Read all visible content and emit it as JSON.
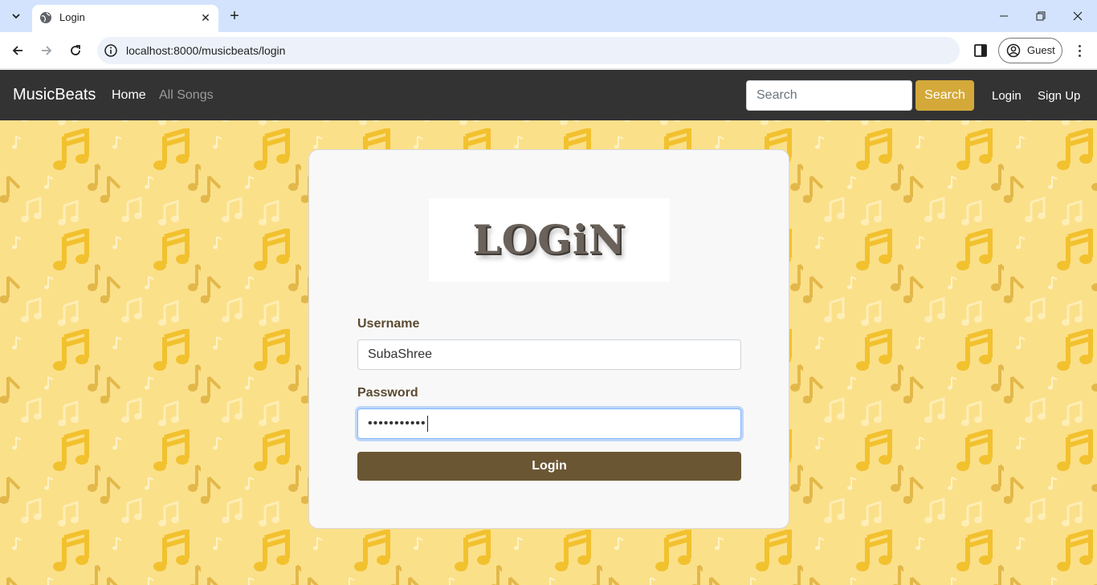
{
  "browser": {
    "tab_title": "Login",
    "url": "localhost:8000/musicbeats/login",
    "profile_label": "Guest"
  },
  "navbar": {
    "brand": "MusicBeats",
    "home": "Home",
    "all_songs": "All Songs",
    "search_placeholder": "Search",
    "search_button": "Search",
    "login": "Login",
    "signup": "Sign Up"
  },
  "login_form": {
    "logo_text": "LOGiN",
    "username_label": "Username",
    "username_value": "SubaShree",
    "password_label": "Password",
    "password_masked": "•••••••••••",
    "submit_label": "Login"
  },
  "colors": {
    "navbar_bg": "#333333",
    "accent": "#d4a93a",
    "button_bg": "#6b5634",
    "page_bg": "#fbe08a"
  }
}
